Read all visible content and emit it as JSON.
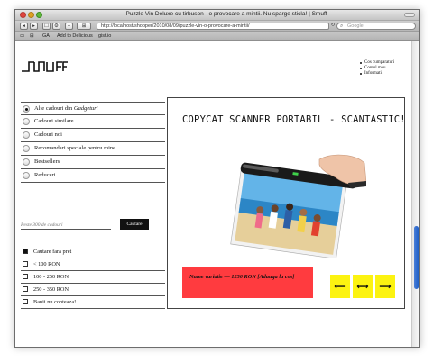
{
  "window": {
    "title": "Puzzle Vin Deluxe cu tirbuson - o provocare a mintii. Nu sparge sticla! | Smuff"
  },
  "toolbar": {
    "back_icon": "back-arrow",
    "forward_icon": "forward-arrow",
    "add_icon": "plus",
    "url": "http://localhost/shopper/2010/08/09/puzzle-vin-o-provocare-a-mintii/",
    "reload_icon": "reload",
    "search_placeholder": "Google"
  },
  "bookmarks": {
    "items": [
      "GA",
      "Add to Delicious",
      "gist.io"
    ]
  },
  "site": {
    "logo_text": "Smuff",
    "top_links": [
      "Cos cumparaturi",
      "Contul meu",
      "Informatii"
    ]
  },
  "sidebar": {
    "first_prefix": "Alte cadouri din ",
    "first_emphasis": "Gadgeturi",
    "items": [
      "Cadouri similare",
      "Cadouri noi",
      "Recomandari speciale pentru mine",
      "Bestsellers",
      "Reduceri"
    ]
  },
  "search": {
    "placeholder": "Peste 300 de cadouri",
    "button_label": "Cautare"
  },
  "price_filter": {
    "items": [
      "Cautare fara pret",
      "< 100 RON",
      "100 - 250 RON",
      "250 - 350 RON",
      "Banii nu conteaza!"
    ],
    "checked_index": 0
  },
  "product": {
    "title": "COPYCAT SCANNER PORTABIL - SCANTASTIC!",
    "price_text": "Nume variatie — 1250 RON    [Adauga la cos]",
    "nav_buttons": [
      "⟵",
      "⟷",
      "⟶"
    ]
  },
  "colors": {
    "price_box": "#ff3b3f",
    "nav_button": "#fcf311",
    "scroll_thumb": "#1e5ec6"
  }
}
